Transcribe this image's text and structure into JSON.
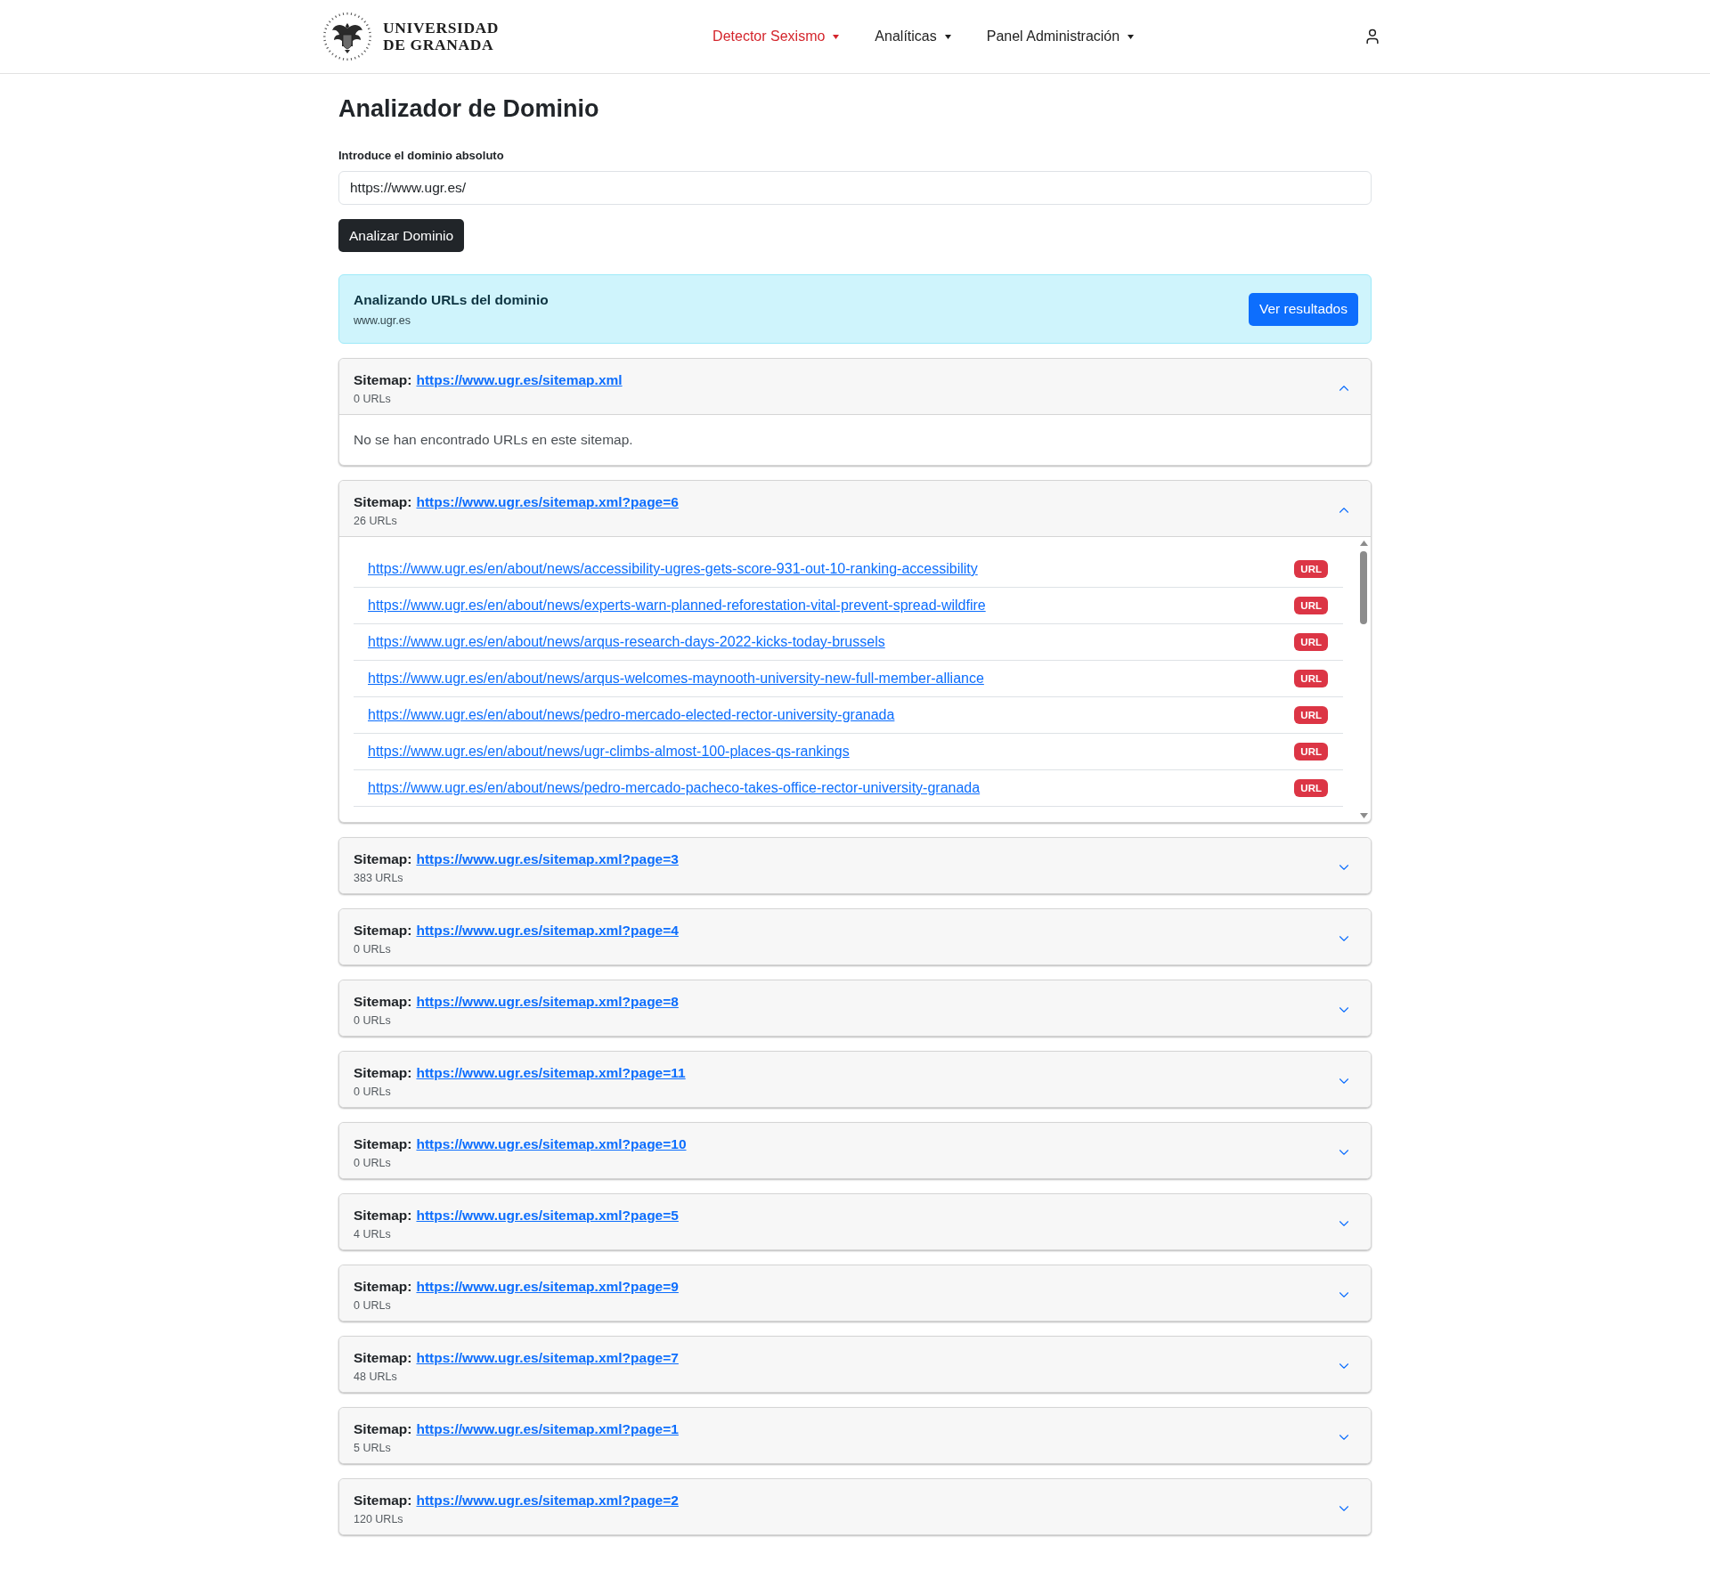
{
  "header": {
    "brand": {
      "lines": [
        "UNIVERSIDAD",
        "DE GRANADA"
      ]
    },
    "nav": [
      {
        "label": "Detector Sexismo",
        "selected": true
      },
      {
        "label": "Analíticas",
        "selected": false
      },
      {
        "label": "Panel Administración",
        "selected": false
      }
    ]
  },
  "page": {
    "title": "Analizador de Dominio",
    "domain_field": {
      "label": "Introduce el dominio absoluto",
      "value": "https://www.ugr.es/"
    },
    "analyze_button": "Analizar Dominio"
  },
  "alert": {
    "title": "Analizando URLs del dominio",
    "domain": "www.ugr.es",
    "button": "Ver resultados"
  },
  "sitemaps": [
    {
      "label": "Sitemap:",
      "url": "https://www.ugr.es/sitemap.xml",
      "count": "0 URLs",
      "expanded": true,
      "message": "No se han encontrado URLs en este sitemap."
    },
    {
      "label": "Sitemap:",
      "url": "https://www.ugr.es/sitemap.xml?page=6",
      "count": "26 URLs",
      "expanded": true,
      "urls": [
        {
          "href": "https://www.ugr.es/en/about/news/accessibility-ugres-gets-score-931-out-10-ranking-accessibility",
          "badge": "URL"
        },
        {
          "href": "https://www.ugr.es/en/about/news/experts-warn-planned-reforestation-vital-prevent-spread-wildfire",
          "badge": "URL"
        },
        {
          "href": "https://www.ugr.es/en/about/news/arqus-research-days-2022-kicks-today-brussels",
          "badge": "URL"
        },
        {
          "href": "https://www.ugr.es/en/about/news/arqus-welcomes-maynooth-university-new-full-member-alliance",
          "badge": "URL"
        },
        {
          "href": "https://www.ugr.es/en/about/news/pedro-mercado-elected-rector-university-granada",
          "badge": "URL"
        },
        {
          "href": "https://www.ugr.es/en/about/news/ugr-climbs-almost-100-places-qs-rankings",
          "badge": "URL"
        },
        {
          "href": "https://www.ugr.es/en/about/news/pedro-mercado-pacheco-takes-office-rector-university-granada",
          "badge": "URL"
        }
      ]
    },
    {
      "label": "Sitemap:",
      "url": "https://www.ugr.es/sitemap.xml?page=3",
      "count": "383 URLs",
      "expanded": false
    },
    {
      "label": "Sitemap:",
      "url": "https://www.ugr.es/sitemap.xml?page=4",
      "count": "0 URLs",
      "expanded": false
    },
    {
      "label": "Sitemap:",
      "url": "https://www.ugr.es/sitemap.xml?page=8",
      "count": "0 URLs",
      "expanded": false
    },
    {
      "label": "Sitemap:",
      "url": "https://www.ugr.es/sitemap.xml?page=11",
      "count": "0 URLs",
      "expanded": false
    },
    {
      "label": "Sitemap:",
      "url": "https://www.ugr.es/sitemap.xml?page=10",
      "count": "0 URLs",
      "expanded": false
    },
    {
      "label": "Sitemap:",
      "url": "https://www.ugr.es/sitemap.xml?page=5",
      "count": "4 URLs",
      "expanded": false
    },
    {
      "label": "Sitemap:",
      "url": "https://www.ugr.es/sitemap.xml?page=9",
      "count": "0 URLs",
      "expanded": false
    },
    {
      "label": "Sitemap:",
      "url": "https://www.ugr.es/sitemap.xml?page=7",
      "count": "48 URLs",
      "expanded": false
    },
    {
      "label": "Sitemap:",
      "url": "https://www.ugr.es/sitemap.xml?page=1",
      "count": "5 URLs",
      "expanded": false
    },
    {
      "label": "Sitemap:",
      "url": "https://www.ugr.es/sitemap.xml?page=2",
      "count": "120 URLs",
      "expanded": false
    }
  ]
}
